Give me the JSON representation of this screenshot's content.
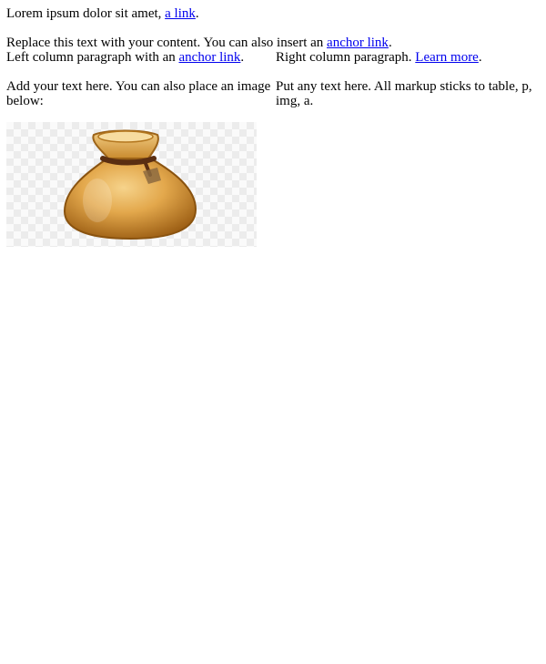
{
  "intro": {
    "text_before_link": "Lorem ipsum dolor sit amet, ",
    "link": "a link",
    "text_after_link": "."
  },
  "replace": {
    "text_before_link": "Replace this text with your content. You can also insert an ",
    "link": "anchor link",
    "text_after_link": "."
  },
  "left_column": {
    "p1_before_link": "Left column paragraph with an ",
    "p1_link": "anchor link",
    "p1_after_link": ".",
    "p2": "Add your text here. You can also place an image below:",
    "image_icon": "money-bag-icon"
  },
  "right_column": {
    "p1_before_link": "Right column paragraph. ",
    "p1_link": "Learn more",
    "p1_after_link": ".",
    "p2": "Put any text here. All markup sticks to table, p, img, a."
  },
  "colors": {
    "link": "#0000ee",
    "bag_main": "#d99a3f",
    "rope": "#5a2e12"
  }
}
